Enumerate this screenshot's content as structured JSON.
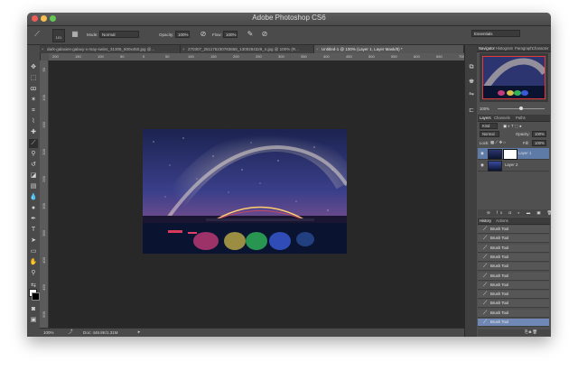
{
  "window": {
    "title": "Adobe Photoshop CS6"
  },
  "options_bar": {
    "brush_size": "101",
    "mode_label": "Mode:",
    "mode_value": "Normal",
    "opacity_label": "Opacity:",
    "opacity_value": "100%",
    "flow_label": "Flow:",
    "flow_value": "100%",
    "workspace": "Essentials"
  },
  "tabs": [
    {
      "label": "dark-galaxies-galaxy-x-may-swiss_31305_600x450.jpg @...",
      "active": false
    },
    {
      "label": "270307_251175230783658_1300284329_n.jpg @ 100% (R...",
      "active": false
    },
    {
      "label": "Untitled-1 @ 100% (Layer 1, Layer Mask/8) *",
      "active": true
    }
  ],
  "ruler_h": [
    "200",
    "150",
    "100",
    "50",
    "0",
    "50",
    "100",
    "150",
    "200",
    "250",
    "300",
    "350",
    "400",
    "450",
    "500",
    "550",
    "600",
    "650",
    "700"
  ],
  "ruler_v": [
    "50",
    "100",
    "150",
    "200",
    "250",
    "300",
    "350",
    "400",
    "450",
    "500"
  ],
  "status": {
    "zoom": "100%",
    "doc": "Doc: 446.8K/1.31M"
  },
  "navigator_panel": {
    "tabs": [
      "Navigator",
      "Histogram",
      "Paragraph",
      "Character"
    ],
    "zoom": "100%"
  },
  "layers_panel": {
    "tabs": [
      "Layers",
      "Channels",
      "Paths"
    ],
    "kind": "Kind",
    "blend_mode": "Normal",
    "opacity_label": "Opacity:",
    "opacity_value": "100%",
    "lock_label": "Lock:",
    "fill_label": "Fill:",
    "fill_value": "100%",
    "layers": [
      {
        "name": "Layer 1",
        "selected": true
      },
      {
        "name": "Layer 2",
        "selected": false
      }
    ]
  },
  "history_panel": {
    "tabs": [
      "History",
      "Actions"
    ],
    "items": [
      "Brush Tool",
      "Brush Tool",
      "Brush Tool",
      "Brush Tool",
      "Brush Tool",
      "Brush Tool",
      "Brush Tool",
      "Brush Tool",
      "Brush Tool",
      "Brush Tool",
      "Brush Tool"
    ]
  }
}
